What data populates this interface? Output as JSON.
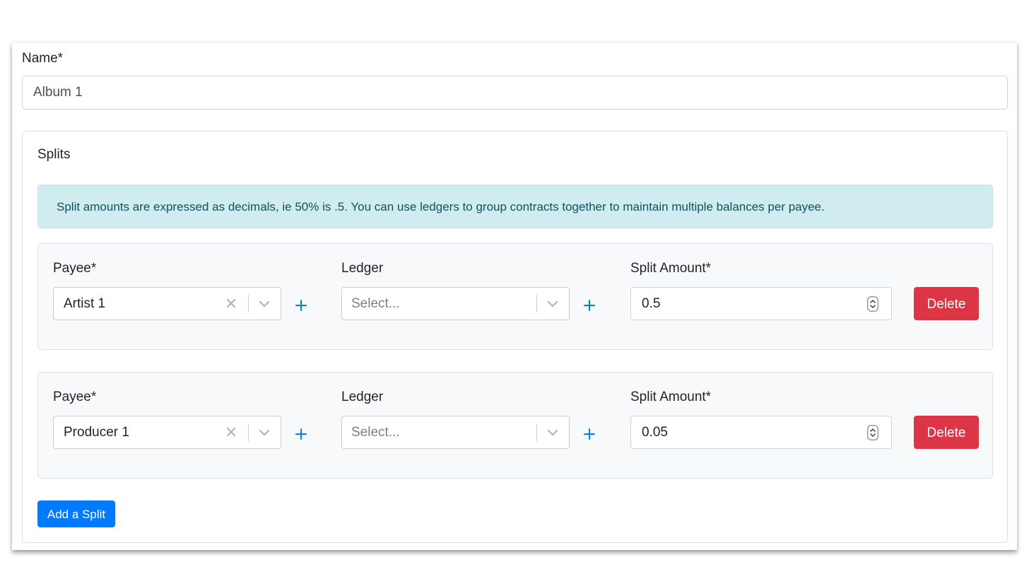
{
  "form": {
    "name_label": "Name*",
    "name_value": "Album 1"
  },
  "splits": {
    "title": "Splits",
    "info_alert": "Split amounts are expressed as decimals, ie 50% is .5. You can use ledgers to group contracts together to maintain multiple balances per payee.",
    "rows": [
      {
        "payee_label": "Payee*",
        "payee_value": "Artist 1",
        "ledger_label": "Ledger",
        "ledger_placeholder": "Select...",
        "amount_label": "Split Amount*",
        "amount_value": "0.5",
        "delete_label": "Delete"
      },
      {
        "payee_label": "Payee*",
        "payee_value": "Producer 1",
        "ledger_label": "Ledger",
        "ledger_placeholder": "Select...",
        "amount_label": "Split Amount*",
        "amount_value": "0.05",
        "delete_label": "Delete"
      }
    ],
    "add_split_label": "Add a Split"
  },
  "icons": {
    "clear": "x-icon",
    "dropdown": "chevron-down-icon",
    "add": "plus-icon",
    "spinner": "number-spinner-icon"
  },
  "colors": {
    "primary": "#007bff",
    "danger": "#dc3545",
    "info_bg": "#d1ecf1",
    "info_text": "#0c5460",
    "row_bg": "#f8f9fa"
  }
}
